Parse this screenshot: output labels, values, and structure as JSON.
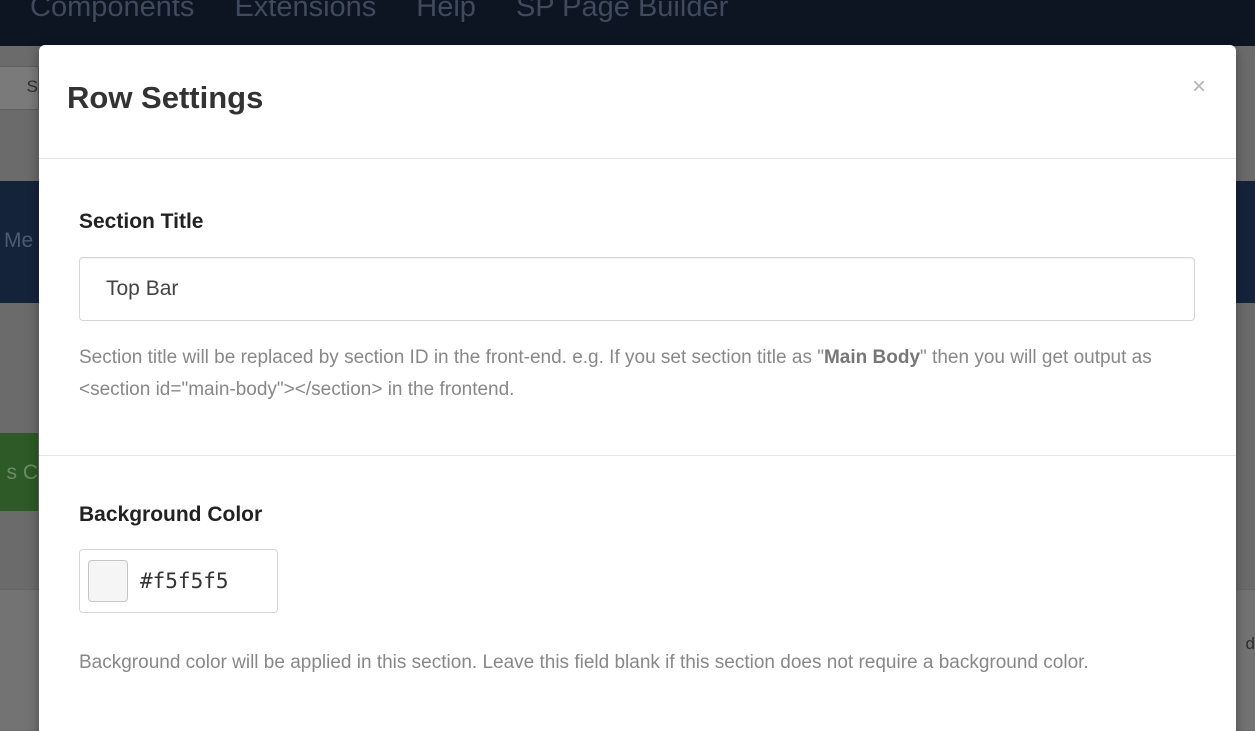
{
  "background": {
    "menu": [
      "Components",
      "Extensions",
      "Help",
      "SP Page Builder"
    ],
    "toolbar_fragment": "S",
    "header_fragment": "Me",
    "green_button_fragment": "s C",
    "right_edge_fragment": "d"
  },
  "modal": {
    "title": "Row Settings",
    "close_symbol": "×",
    "section_title": {
      "label": "Section Title",
      "value": "Top Bar",
      "help_before": "Section title will be replaced by section ID in the front-end. e.g. If you set section title as \"",
      "help_bold": "Main Body",
      "help_after": "\" then you will get output as <section id=\"main-body\"></section> in the frontend."
    },
    "background_color": {
      "label": "Background Color",
      "value": "#f5f5f5",
      "swatch_color": "#f5f5f5",
      "help": "Background color will be applied in this section. Leave this field blank if this section does not require a background color."
    }
  }
}
